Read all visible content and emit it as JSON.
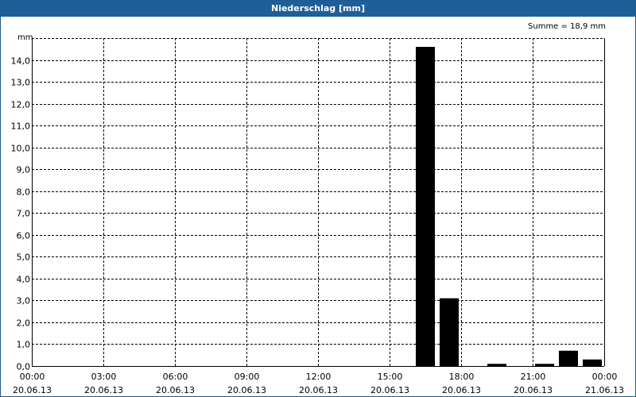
{
  "window": {
    "title": "Niederschlag [mm]"
  },
  "chart_data": {
    "type": "bar",
    "title": "Niederschlag [mm]",
    "unit_label": "mm",
    "sum_label": "Summe = 18,9 mm",
    "ylim": [
      0,
      15
    ],
    "ytick_values": [
      0,
      1,
      2,
      3,
      4,
      5,
      6,
      7,
      8,
      9,
      10,
      11,
      12,
      13,
      14
    ],
    "ytick_labels": [
      "0,0",
      "1,0",
      "2,0",
      "3,0",
      "4,0",
      "5,0",
      "6,0",
      "7,0",
      "8,0",
      "9,0",
      "10,0",
      "11,0",
      "12,0",
      "13,0",
      "14,0"
    ],
    "xlim_hours": [
      0,
      24
    ],
    "xticks": [
      {
        "hour": 0,
        "time": "00:00",
        "date": "20.06.13"
      },
      {
        "hour": 3,
        "time": "03:00",
        "date": "20.06.13"
      },
      {
        "hour": 6,
        "time": "06:00",
        "date": "20.06.13"
      },
      {
        "hour": 9,
        "time": "09:00",
        "date": "20.06.13"
      },
      {
        "hour": 12,
        "time": "12:00",
        "date": "20.06.13"
      },
      {
        "hour": 15,
        "time": "15:00",
        "date": "20.06.13"
      },
      {
        "hour": 18,
        "time": "18:00",
        "date": "20.06.13"
      },
      {
        "hour": 21,
        "time": "21:00",
        "date": "20.06.13"
      },
      {
        "hour": 24,
        "time": "00:00",
        "date": "21.06.13"
      }
    ],
    "bars": [
      {
        "start_hour": 16,
        "end_hour": 17,
        "value": 14.6
      },
      {
        "start_hour": 17,
        "end_hour": 18,
        "value": 3.1
      },
      {
        "start_hour": 19,
        "end_hour": 20,
        "value": 0.1
      },
      {
        "start_hour": 21,
        "end_hour": 22,
        "value": 0.1
      },
      {
        "start_hour": 22,
        "end_hour": 23,
        "value": 0.7
      },
      {
        "start_hour": 23,
        "end_hour": 24,
        "value": 0.3
      }
    ],
    "grid": true,
    "bar_color": "#000000",
    "grid_color": "#000000"
  }
}
